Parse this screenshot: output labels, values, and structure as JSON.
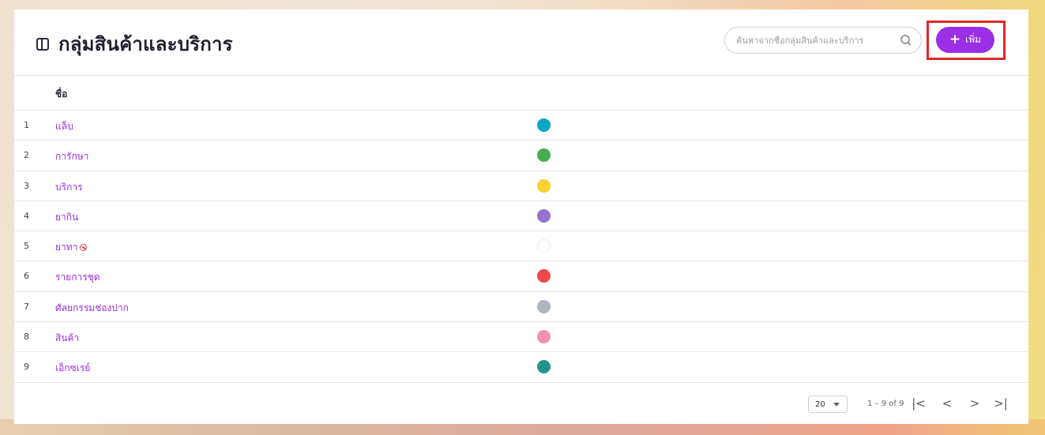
{
  "header": {
    "title": "กลุ่มสินค้าและบริการ",
    "search_placeholder": "ค้นหาจากชื่อกลุ่มสินค้าและบริการ",
    "add_label": "เพิ่ม"
  },
  "table": {
    "column_name": "ชื่อ",
    "rows": [
      {
        "num": "1",
        "name": "แล็บ",
        "color": "#0aa6c5",
        "disabled": false
      },
      {
        "num": "2",
        "name": "การักษา",
        "color": "#46ad4f",
        "disabled": false
      },
      {
        "num": "3",
        "name": "บริการ",
        "color": "#fbd22e",
        "disabled": false
      },
      {
        "num": "4",
        "name": "ยากิน",
        "color": "#9572cf",
        "disabled": false
      },
      {
        "num": "5",
        "name": "ยาทา",
        "color": "#ffffff",
        "disabled": true
      },
      {
        "num": "6",
        "name": "รายการชุด",
        "color": "#ec4848",
        "disabled": false
      },
      {
        "num": "7",
        "name": "ศัลยกรรมช่องปาก",
        "color": "#adb6c1",
        "disabled": false
      },
      {
        "num": "8",
        "name": "สินค้า",
        "color": "#f590ae",
        "disabled": false
      },
      {
        "num": "9",
        "name": "เอ็กซเรย์",
        "color": "#22968a",
        "disabled": false
      }
    ]
  },
  "pagination": {
    "page_size": "20",
    "range": "1 – 9 of 9",
    "first": "|<",
    "prev": "<",
    "next": ">",
    "last": ">|"
  }
}
